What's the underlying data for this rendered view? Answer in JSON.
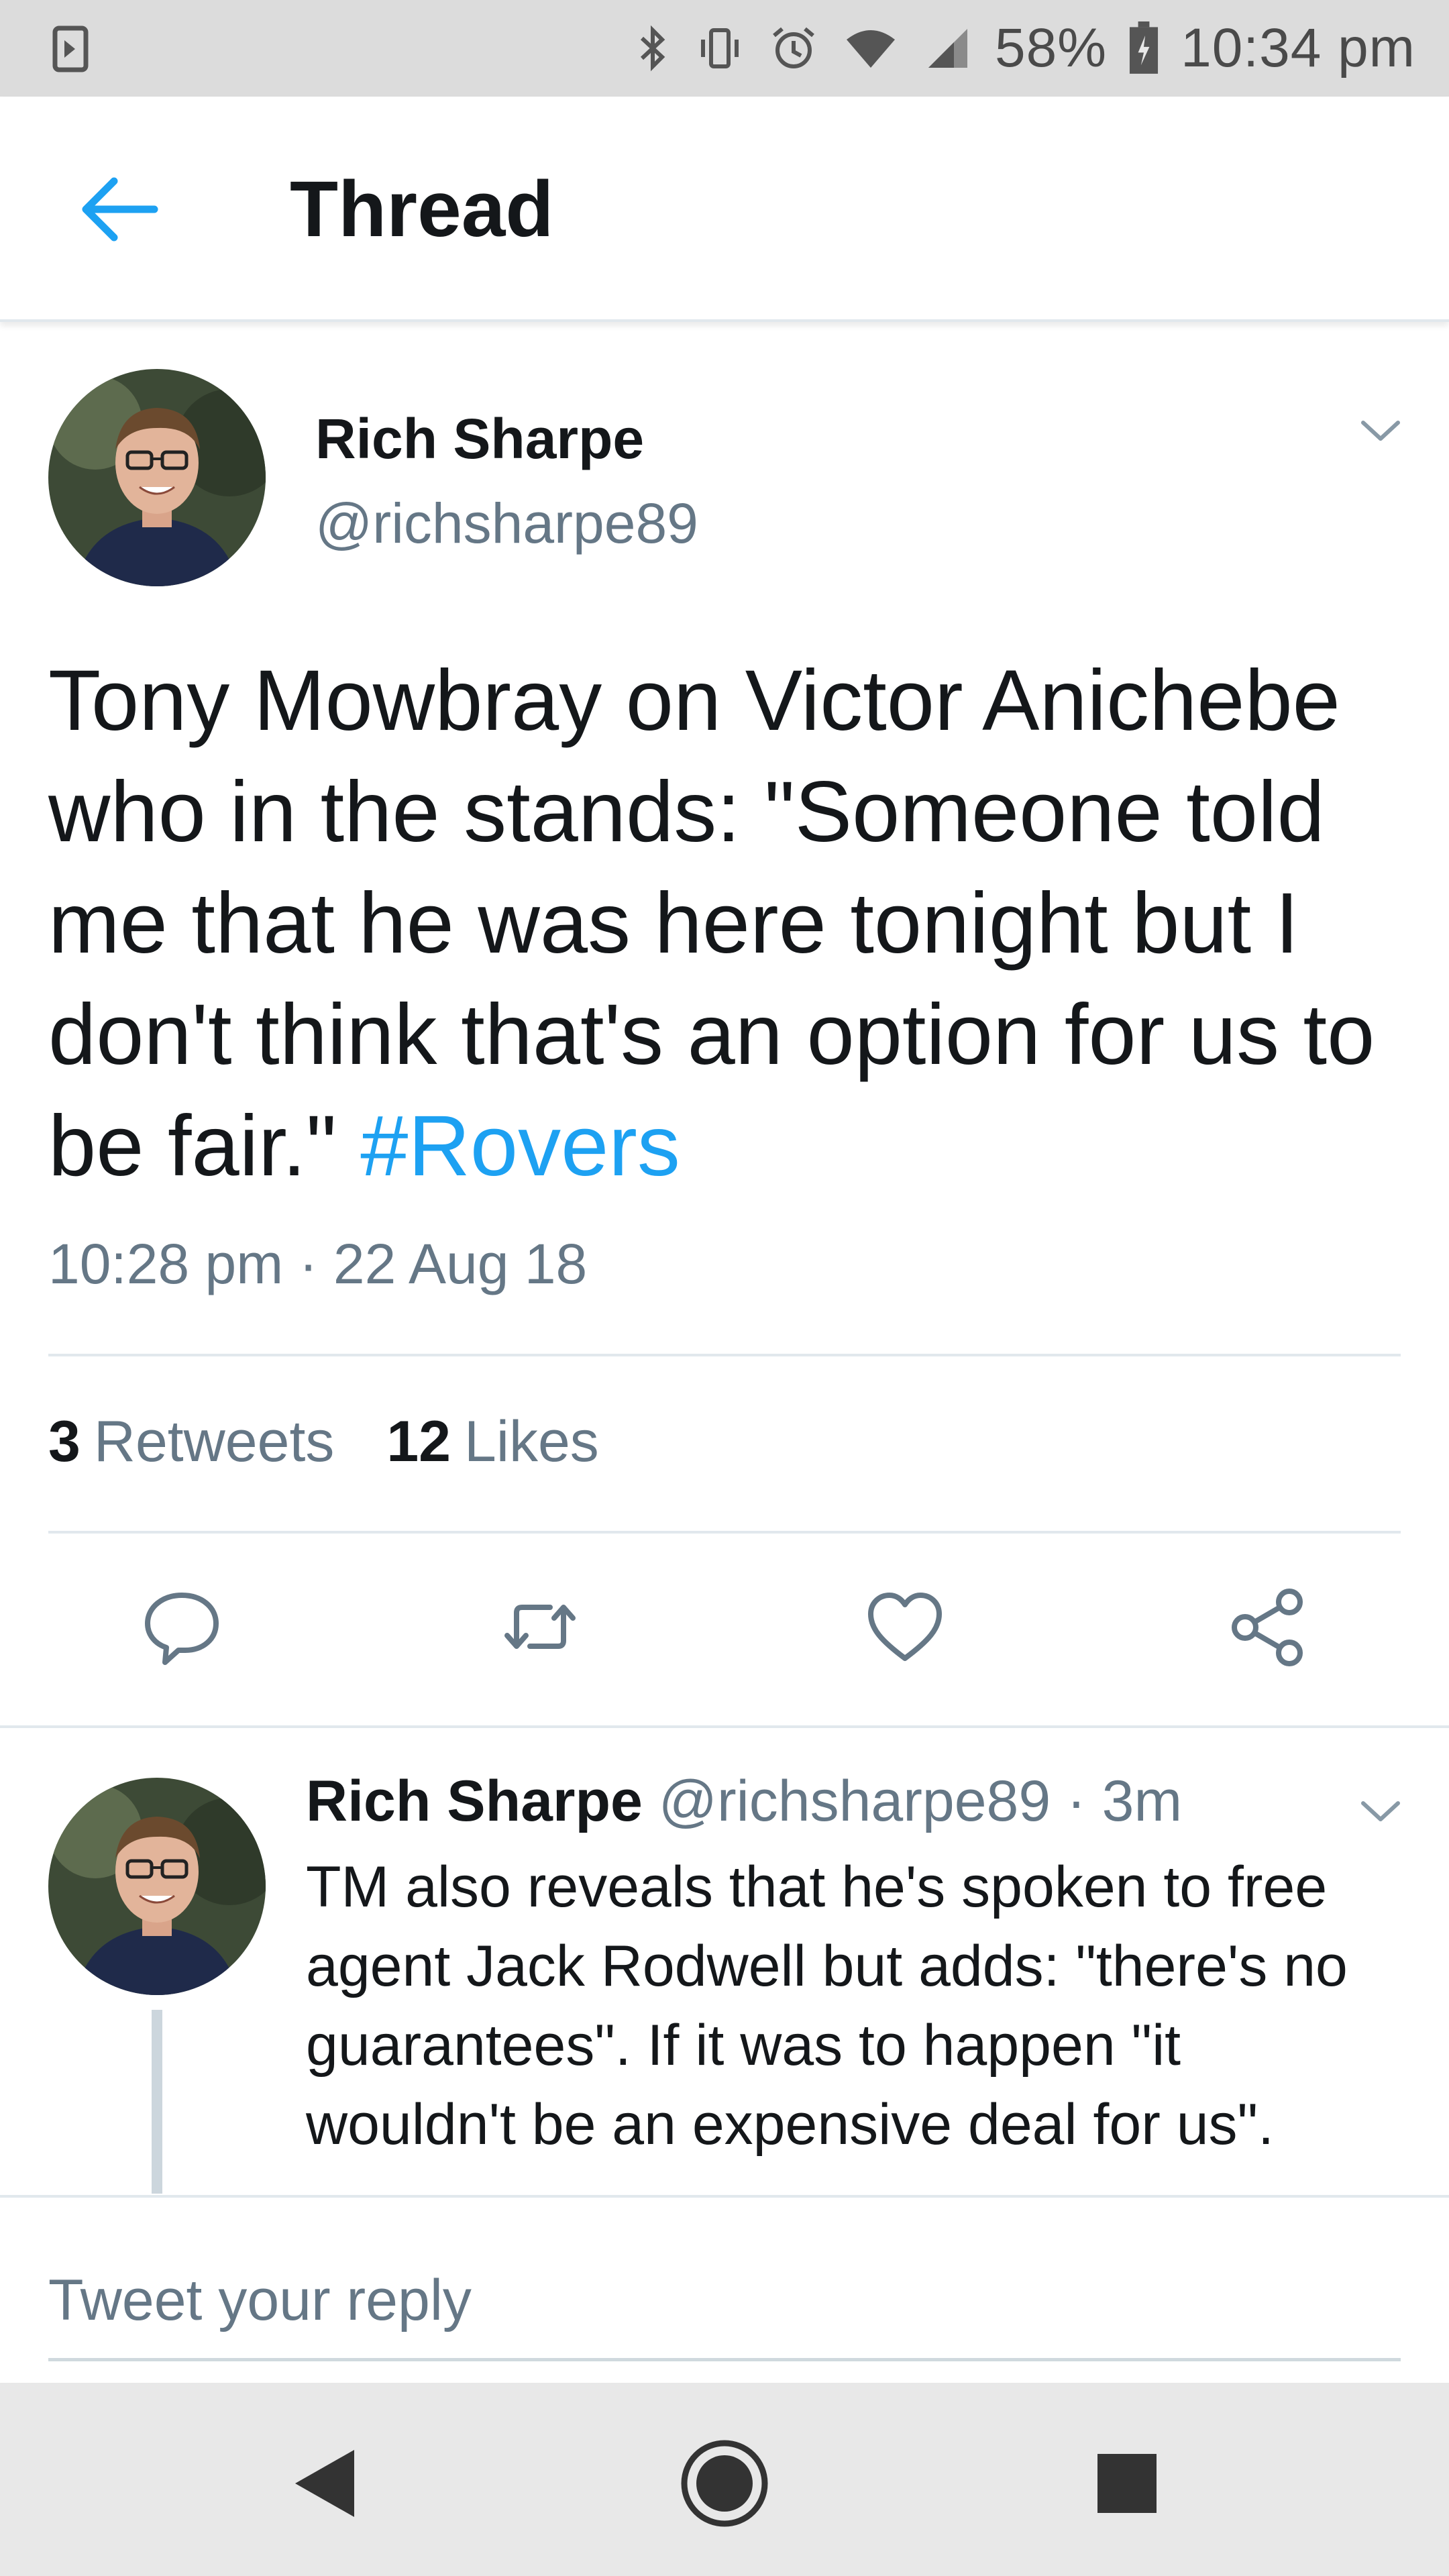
{
  "status_bar": {
    "battery": "58%",
    "time": "10:34 pm",
    "icons": [
      "notification-icon",
      "bluetooth-icon",
      "vibrate-icon",
      "alarm-icon",
      "wifi-icon",
      "signal-icon",
      "battery-icon"
    ]
  },
  "header": {
    "title": "Thread",
    "back_icon": "back-arrow-icon"
  },
  "main_tweet": {
    "author_name": "Rich Sharpe",
    "author_handle": "@richsharpe89",
    "text": "Tony Mowbray on Victor Anichebe who in the stands: \"Someone told me that he was here tonight but I don't think that's an option for us to be fair.\" ",
    "hashtag": "#Rovers",
    "timestamp": "10:28 pm · 22 Aug 18",
    "retweet_count": "3",
    "retweet_label": "Retweets",
    "like_count": "12",
    "like_label": "Likes",
    "actions": [
      "reply-icon",
      "retweet-icon",
      "like-icon",
      "share-icon"
    ]
  },
  "reply_tweet": {
    "author_name": "Rich Sharpe",
    "meta": "@richsharpe89 · 3m",
    "text": "TM also reveals that he's spoken to free agent Jack Rodwell but adds: \"there's no guarantees\". If it was to happen \"it wouldn't be an expensive deal for us\"."
  },
  "composer": {
    "placeholder": "Tweet your reply"
  },
  "nav_bar": {
    "buttons": [
      "back-nav-icon",
      "home-nav-icon",
      "recents-nav-icon"
    ]
  },
  "colors": {
    "accent": "#1da1f2",
    "secondary_text": "#657786",
    "divider": "#e1e8ed"
  }
}
